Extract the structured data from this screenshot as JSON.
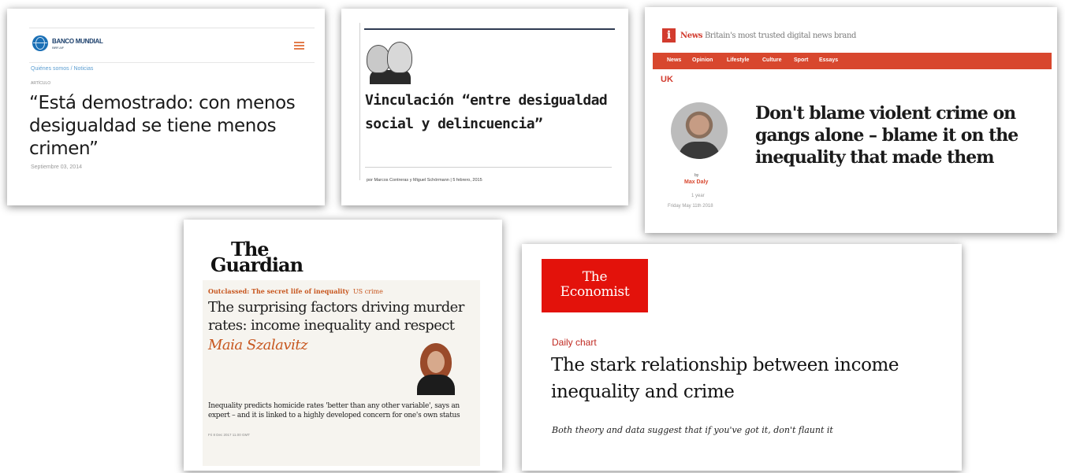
{
  "banco_mundial": {
    "brand": "BANCO MUNDIAL",
    "brand_sub": "BIRF-AIF",
    "breadcrumb": "Quiénes somos  /  Noticias",
    "kicker": "ARTÍCULO",
    "title": "“Está demostrado: con menos desigualdad se tiene menos crimen”",
    "date": "Septiembre 03, 2014",
    "accent": "#e27c4c"
  },
  "vinculacion": {
    "title": "Vinculación “entre desigualdad social y delincuencia”",
    "byline": "por Marcos Contreras y Miguel Schörmann   |   5 febrero, 2015"
  },
  "inews": {
    "logo_letter": "i",
    "brand": "News",
    "tagline": "Britain's most trusted digital news brand",
    "nav": [
      "News",
      "Opinion",
      "Lifestyle",
      "Culture",
      "Sport",
      "Essays"
    ],
    "section": "UK",
    "by": "by",
    "author": "Max Daly",
    "ago": "1 year",
    "date": "Friday May 11th 2018",
    "title": "Don't blame violent crime on gangs alone – blame it on the inequality that made them",
    "accent": "#d8472e"
  },
  "guardian": {
    "logo_line1": "The",
    "logo_line2": "Guardian",
    "series": "Outclassed: The secret life of inequality",
    "section": "US crime",
    "title": "The surprising factors driving murder rates: income inequality and respect",
    "author": "Maia Szalavitz",
    "standfirst": "Inequality predicts homicide rates 'better than any other variable', says an expert – and it is linked to a highly developed concern for one's own status",
    "date": "Fri 8 Dec 2017 11.00 GMT",
    "accent": "#c7561e"
  },
  "economist": {
    "logo_line1": "The",
    "logo_line2": "Economist",
    "kicker": "Daily chart",
    "title": "The stark relationship between income inequality and crime",
    "subtitle": "Both theory and data suggest that if you've got it, don't flaunt it",
    "accent": "#e3120b"
  }
}
